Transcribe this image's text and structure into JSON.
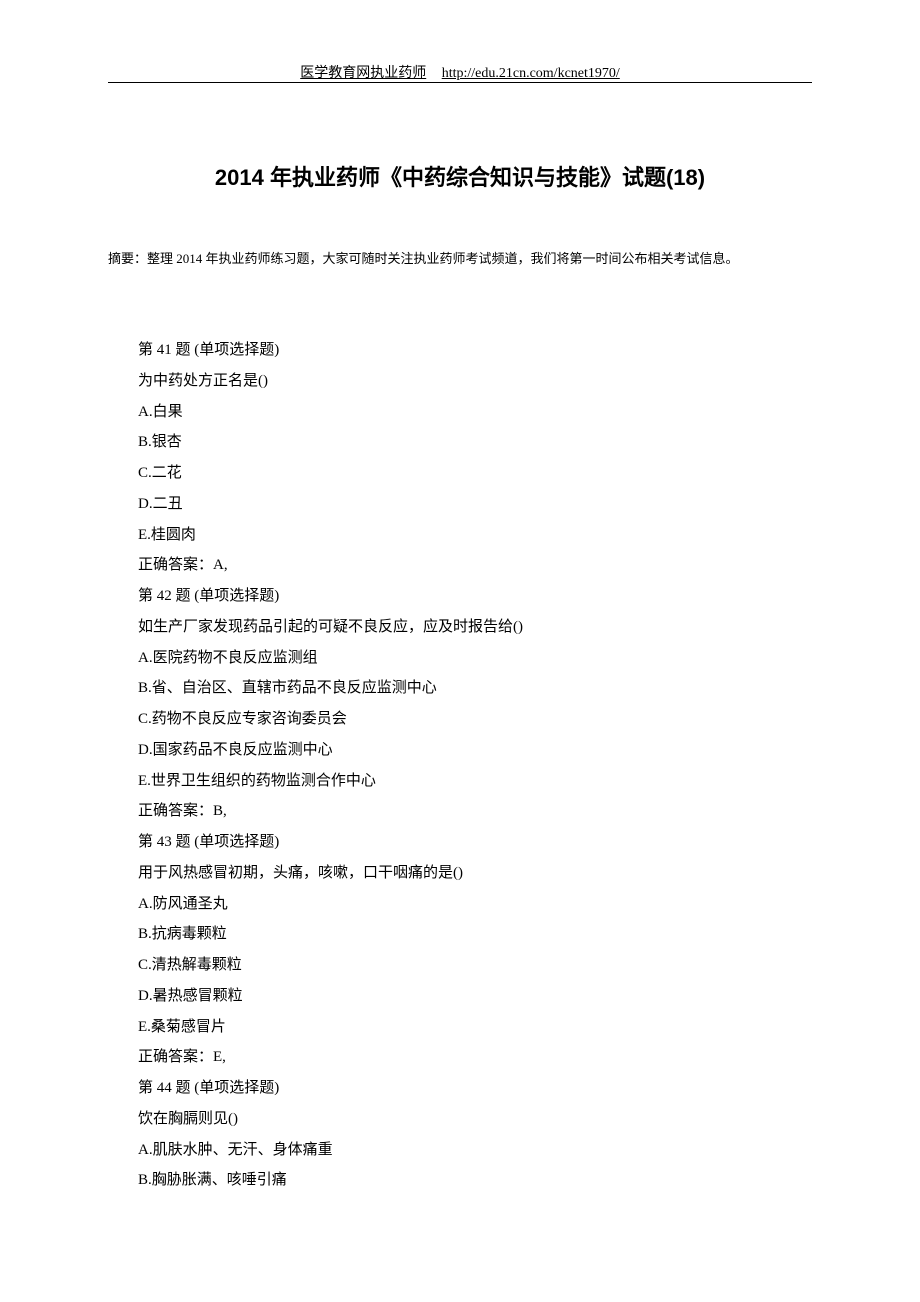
{
  "header": {
    "label": "医学教育网执业药师",
    "url": "http://edu.21cn.com/kcnet1970/"
  },
  "title": "2014 年执业药师《中药综合知识与技能》试题(18)",
  "abstract": "摘要：整理 2014 年执业药师练习题，大家可随时关注执业药师考试频道，我们将第一时间公布相关考试信息。",
  "questions": [
    {
      "header": "第 41 题 (单项选择题)",
      "stem": "为中药处方正名是()",
      "options": [
        "A.白果",
        "B.银杏",
        "C.二花",
        "D.二丑",
        "E.桂圆肉"
      ],
      "answer": "正确答案：A,"
    },
    {
      "header": "第 42 题 (单项选择题)",
      "stem": "如生产厂家发现药品引起的可疑不良反应，应及时报告给()",
      "options": [
        "A.医院药物不良反应监测组",
        "B.省、自治区、直辖市药品不良反应监测中心",
        "C.药物不良反应专家咨询委员会",
        "D.国家药品不良反应监测中心",
        "E.世界卫生组织的药物监测合作中心"
      ],
      "answer": "正确答案：B,"
    },
    {
      "header": "第 43 题 (单项选择题)",
      "stem": "用于风热感冒初期，头痛，咳嗽，口干咽痛的是()",
      "options": [
        "A.防风通圣丸",
        "B.抗病毒颗粒",
        "C.清热解毒颗粒",
        "D.暑热感冒颗粒",
        "E.桑菊感冒片"
      ],
      "answer": "正确答案：E,"
    },
    {
      "header": "第 44 题 (单项选择题)",
      "stem": "饮在胸膈则见()",
      "options": [
        "A.肌肤水肿、无汗、身体痛重",
        "B.胸胁胀满、咳唾引痛"
      ],
      "answer": ""
    }
  ]
}
